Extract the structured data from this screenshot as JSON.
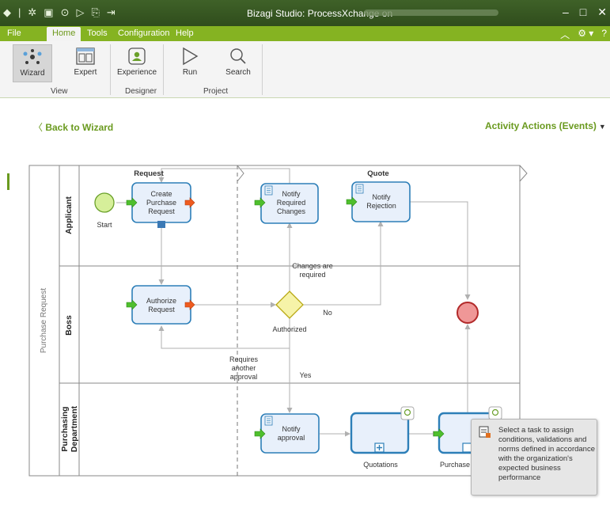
{
  "window": {
    "title": "Bizagi Studio: ProcessXchange  on",
    "controls": [
      "–",
      "□",
      "✕"
    ]
  },
  "menu": {
    "tabs": [
      "File",
      "Home",
      "Tools",
      "Configuration",
      "Help"
    ],
    "active": "Home"
  },
  "ribbon": {
    "buttons": {
      "wizard": "Wizard",
      "expert": "Expert",
      "experience": "Experience",
      "run": "Run",
      "search": "Search"
    },
    "groups": {
      "view": "View",
      "designer": "Designer",
      "project": "Project"
    }
  },
  "page": {
    "back_label": "Back to Wizard",
    "actions_label": "Activity Actions (Events)"
  },
  "diagram": {
    "pool": "Purchase Request",
    "lanes": [
      "Applicant",
      "Boss",
      "Purchasing Department"
    ],
    "milestones": [
      "Request",
      "Quote"
    ],
    "tasks": {
      "create": "Create Purchase Request",
      "notify_changes": "Notify Required Changes",
      "notify_rejection": "Notify Rejection",
      "authorize": "Authorize Request",
      "notify_approval": "Notify approval",
      "quotations": "Quotations",
      "purchase": "Purchase"
    },
    "start_label": "Start",
    "gateway_label": "Authorized",
    "flows": {
      "changes": "Changes are required",
      "no": "No",
      "another": "Requires another approval",
      "yes": "Yes"
    }
  },
  "tooltip": {
    "text": "Select a task to assign conditions, validations and norms defined in accordance with the organization's expected business performance"
  },
  "colors": {
    "brand": "#85b322",
    "title_bar": "#3f6128",
    "link": "#6a9a1f",
    "task_fill": "#e8f0fb",
    "task_border": "#2d7fb8"
  }
}
